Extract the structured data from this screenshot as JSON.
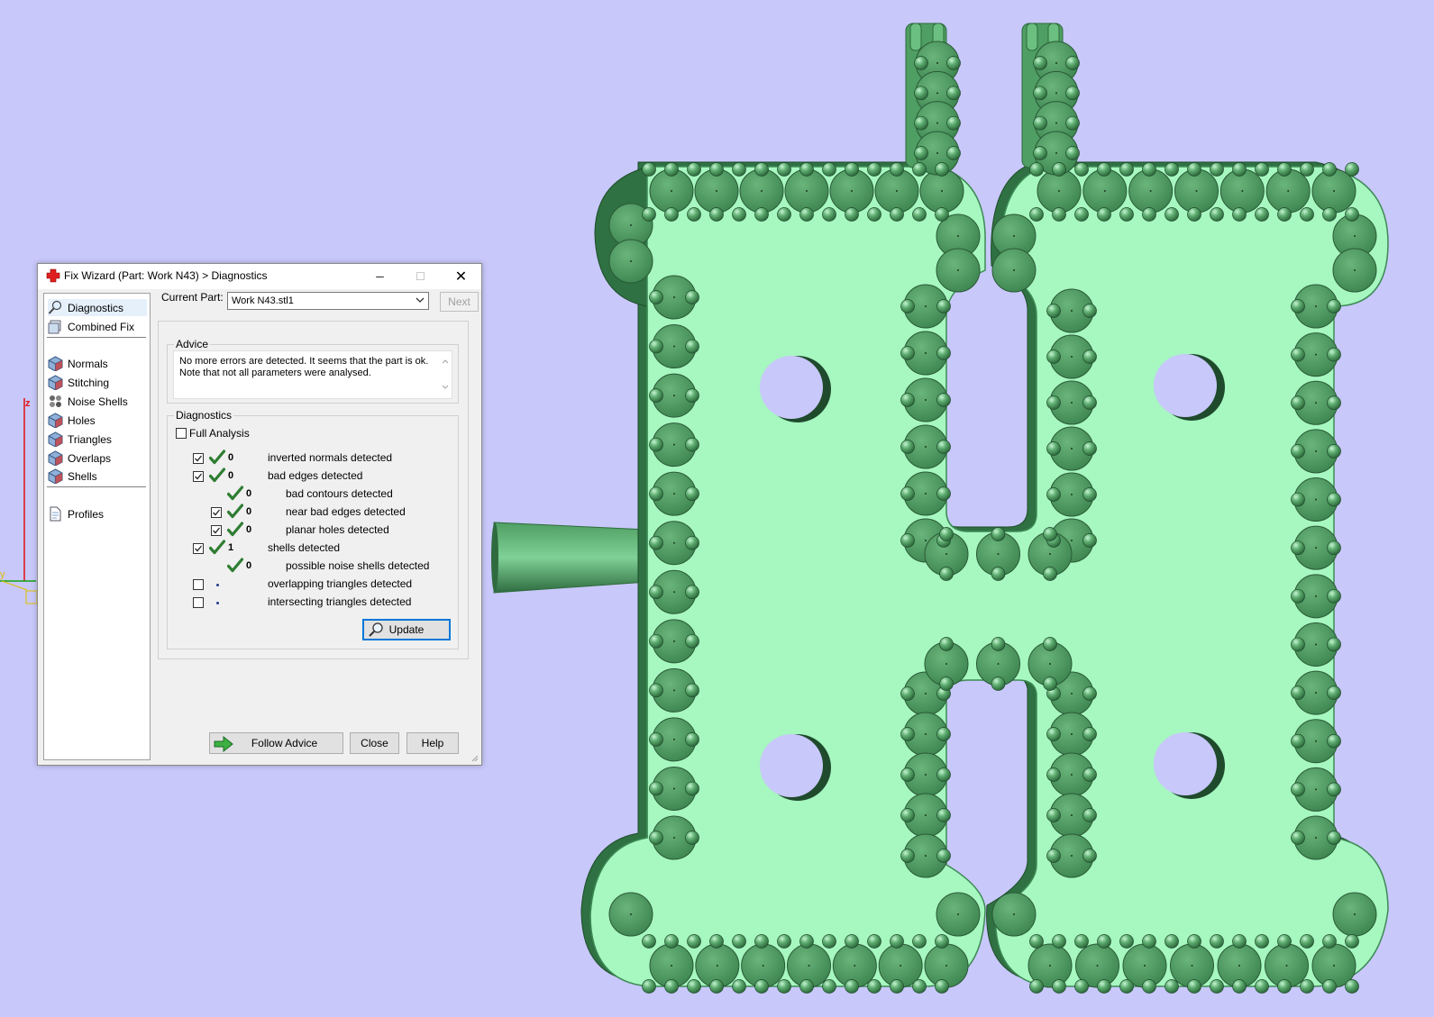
{
  "window": {
    "title": "Fix Wizard (Part: Work N43) > Diagnostics",
    "controls": {
      "minimize": "─",
      "maximize": "☐",
      "close": "✕"
    }
  },
  "nav": {
    "items": [
      {
        "label": "Diagnostics",
        "icon": "magnifier-icon",
        "selected": true
      },
      {
        "label": "Combined Fix",
        "icon": "combined-fix-icon"
      },
      {
        "label": "Normals",
        "icon": "normals-cube-icon"
      },
      {
        "label": "Stitching",
        "icon": "stitching-cube-icon"
      },
      {
        "label": "Noise Shells",
        "icon": "noise-shells-icon"
      },
      {
        "label": "Holes",
        "icon": "holes-cube-icon"
      },
      {
        "label": "Triangles",
        "icon": "triangles-cube-icon"
      },
      {
        "label": "Overlaps",
        "icon": "overlaps-cube-icon"
      },
      {
        "label": "Shells",
        "icon": "shells-cube-icon"
      },
      {
        "label": "Profiles",
        "icon": "document-icon"
      }
    ]
  },
  "part": {
    "label": "Current Part:",
    "value": "Work N43.stl1",
    "next_label": "Next"
  },
  "advice": {
    "title": "Advice",
    "text_line1": "No more errors are detected. It seems that the part is ok.",
    "text_line2": "Note that not all parameters were analysed."
  },
  "diagnostics": {
    "title": "Diagnostics",
    "full_analysis_label": "Full Analysis",
    "rows": [
      {
        "checked": true,
        "ok": true,
        "count": "0",
        "label": "inverted normals detected",
        "indent": 0,
        "has_checkbox": true
      },
      {
        "checked": true,
        "ok": true,
        "count": "0",
        "label": "bad edges detected",
        "indent": 0,
        "has_checkbox": true
      },
      {
        "checked": false,
        "ok": true,
        "count": "0",
        "label": "bad contours detected",
        "indent": 1,
        "has_checkbox": false
      },
      {
        "checked": true,
        "ok": true,
        "count": "0",
        "label": "near bad edges detected",
        "indent": 1,
        "has_checkbox": true
      },
      {
        "checked": true,
        "ok": true,
        "count": "0",
        "label": "planar holes detected",
        "indent": 1,
        "has_checkbox": true
      },
      {
        "checked": true,
        "ok": true,
        "count": "1",
        "label": "shells detected",
        "indent": 0,
        "has_checkbox": true
      },
      {
        "checked": false,
        "ok": true,
        "count": "0",
        "label": "possible noise shells detected",
        "indent": 1,
        "has_checkbox": false
      },
      {
        "checked": false,
        "ok": false,
        "count": "",
        "label": "overlapping triangles detected",
        "indent": 0,
        "has_checkbox": true
      },
      {
        "checked": false,
        "ok": false,
        "count": "",
        "label": "intersecting triangles detected",
        "indent": 0,
        "has_checkbox": true
      }
    ],
    "update_label": "Update"
  },
  "footer": {
    "follow_advice_label": "Follow Advice",
    "close_label": "Close",
    "help_label": "Help"
  },
  "axes": {
    "z_label": "z",
    "y_label": "y"
  },
  "colors": {
    "background": "#c8c8fa",
    "part_fill": "#a6f7c0",
    "part_edge": "#3d8a55",
    "sphere": "#4f9e63",
    "accent": "#0078d7",
    "check": "#2e7d32"
  }
}
